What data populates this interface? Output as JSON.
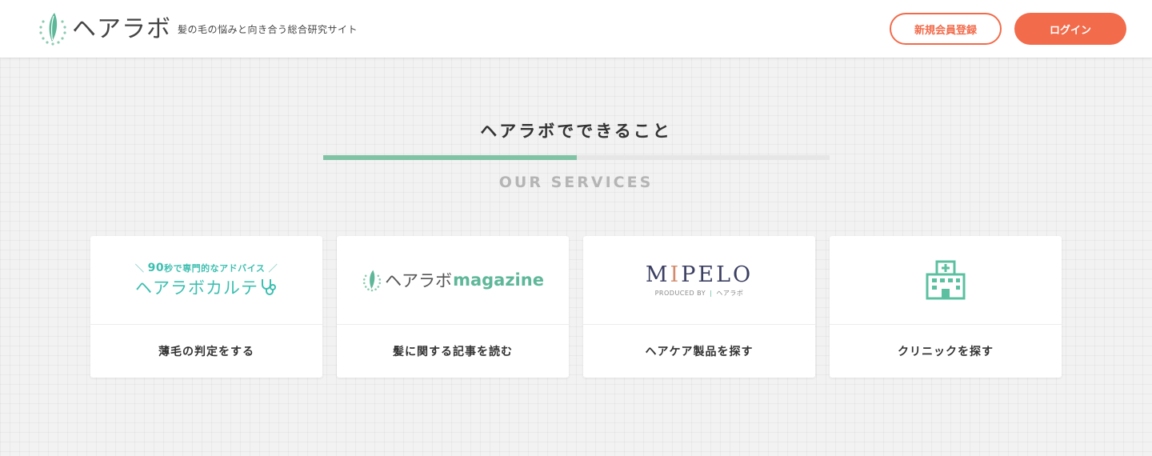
{
  "header": {
    "logo_text": "ヘアラボ",
    "tagline": "髪の毛の悩みと向き合う総合研究サイト",
    "register_label": "新規会員登録",
    "login_label": "ログイン"
  },
  "section": {
    "title": "ヘアラボでできること",
    "subtitle": "OUR SERVICES",
    "progress": 0.5
  },
  "cards": [
    {
      "logo_sub_num": "90",
      "logo_sub_text": "秒で専門的なアドバイス",
      "logo_main": "ヘアラボカルテ",
      "label": "薄毛の判定をする"
    },
    {
      "logo_ja": "ヘアラボ",
      "logo_en": "magazine",
      "label": "髪に関する記事を読む"
    },
    {
      "logo_pre": "M",
      "logo_i": "I",
      "logo_post": "PELO",
      "logo_sub": "PRODUCED BY",
      "logo_sub_brand": "ヘアラボ",
      "label": "ヘアケア製品を探す"
    },
    {
      "icon": "hospital-icon",
      "label": "クリニックを探す"
    }
  ],
  "colors": {
    "accent": "#f26b4b",
    "green": "#7fc3a4",
    "teal": "#3dbfb0",
    "navy": "#3b3f62"
  }
}
